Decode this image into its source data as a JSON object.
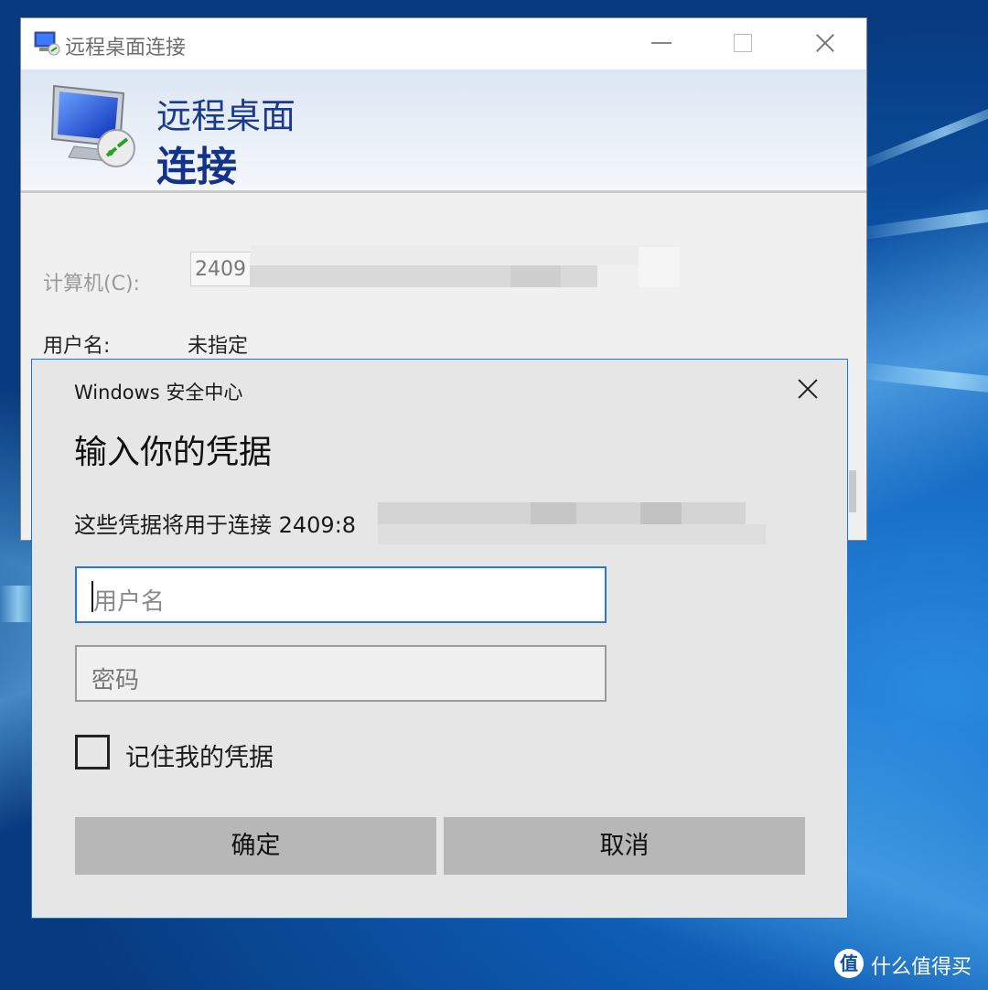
{
  "rdp_window": {
    "title": "远程桌面连接",
    "banner_line1": "远程桌面",
    "banner_line2": "连接",
    "computer_label": "计算机(C):",
    "computer_value": "2409",
    "username_label": "用户名:",
    "username_value": "未指定"
  },
  "security_dialog": {
    "caption": "Windows 安全中心",
    "heading": "输入你的凭据",
    "description": "这些凭据将用于连接 2409:8",
    "username_placeholder": "用户名",
    "password_placeholder": "密码",
    "remember_label": "记住我的凭据",
    "remember_checked": false,
    "ok_label": "确定",
    "cancel_label": "取消"
  },
  "watermark": {
    "text": "什么值得买"
  },
  "colors": {
    "dialog_border": "#1a73d8",
    "input_focus": "#2b78d4",
    "banner_text": "#1b3a8c",
    "desktop": "#0a3f86"
  }
}
